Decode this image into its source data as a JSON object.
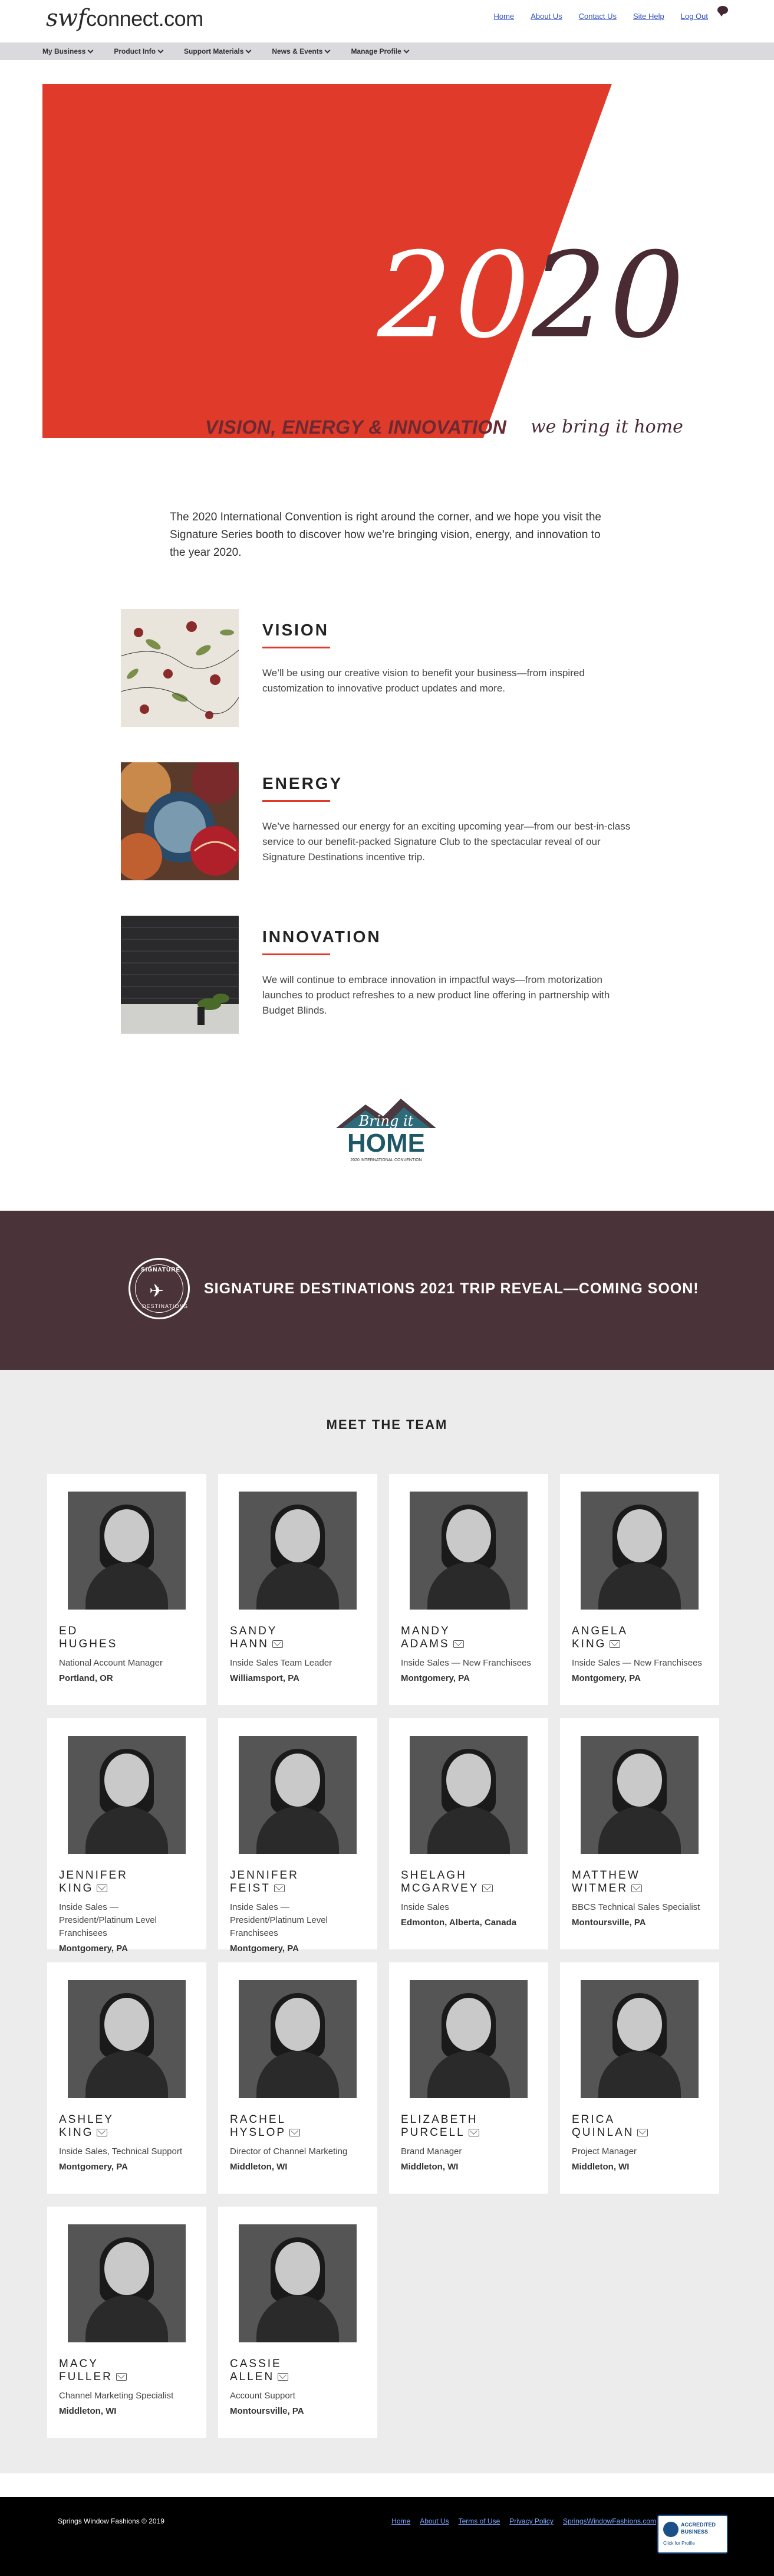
{
  "header": {
    "logo_swf": "swf",
    "logo_rest": "connect.com",
    "links": [
      "Home",
      "About Us",
      "Contact Us",
      "Site Help",
      "Log Out"
    ]
  },
  "nav": {
    "items": [
      "My Business",
      "Product Info",
      "Support Materials",
      "News & Events",
      "Manage Profile"
    ]
  },
  "hero": {
    "year_white": "20",
    "year_dark": "20",
    "tagline": "VISION, ENERGY & INNOVATION",
    "subtagline": "we bring it home",
    "colors": {
      "red": "#e03a2a",
      "dark": "#4a2a33"
    }
  },
  "intro": "The 2020 International Convention is right around the corner, and we hope you visit the Signature Series booth to discover how we’re bringing vision, energy, and innovation to the year 2020.",
  "features": [
    {
      "title": "VISION",
      "text": "We’ll be using our creative vision to benefit your business—from inspired customization to innovative product updates and more."
    },
    {
      "title": "ENERGY",
      "text": "We’ve harnessed our energy for an exciting upcoming year—from our best-in-class service to our benefit-packed Signature Club to the spectacular reveal of our Signature Destinations incentive trip."
    },
    {
      "title": "INNOVATION",
      "text": "We will continue to embrace innovation in impactful ways—from motorization launches to product refreshes to a new product line offering in partnership with Budget Blinds."
    }
  ],
  "bring_home": {
    "script": "Bring it",
    "word": "HOME",
    "caption": "2020 INTERNATIONAL CONVENTION"
  },
  "banner": {
    "text": "SIGNATURE DESTINATIONS 2021 TRIP REVEAL—COMING SOON!",
    "badge_top": "SIGNATURE",
    "badge_bottom": "DESTINATIONS"
  },
  "team": {
    "title": "MEET THE TEAM",
    "members": [
      {
        "name": "ED\nHUGHES",
        "role": "National Account Manager",
        "location": "Portland, OR",
        "mail": false
      },
      {
        "name": "SANDY\nHANN",
        "role": "Inside Sales Team Leader",
        "location": "Williamsport, PA",
        "mail": true
      },
      {
        "name": "MANDY\nADAMS",
        "role": "Inside Sales — New Franchisees",
        "location": "Montgomery, PA",
        "mail": true
      },
      {
        "name": "ANGELA\nKING",
        "role": "Inside Sales — New Franchisees",
        "location": "Montgomery, PA",
        "mail": true
      },
      {
        "name": "JENNIFER\nKING",
        "role": "Inside Sales — President/Platinum Level Franchisees",
        "location": "Montgomery, PA",
        "mail": true
      },
      {
        "name": "JENNIFER\nFEIST",
        "role": "Inside Sales — President/Platinum Level Franchisees",
        "location": "Montgomery, PA",
        "mail": true
      },
      {
        "name": "SHELAGH\nMCGARVEY",
        "role": "Inside Sales",
        "location": "Edmonton, Alberta, Canada",
        "mail": true
      },
      {
        "name": "MATTHEW\nWITMER",
        "role": "BBCS Technical Sales Specialist",
        "location": "Montoursville, PA",
        "mail": true
      },
      {
        "name": "ASHLEY\nKING",
        "role": "Inside Sales, Technical Support",
        "location": "Montgomery, PA",
        "mail": true
      },
      {
        "name": "RACHEL\nHYSLOP",
        "role": "Director of Channel Marketing",
        "location": "Middleton, WI",
        "mail": true
      },
      {
        "name": "ELIZABETH\nPURCELL",
        "role": "Brand Manager",
        "location": "Middleton, WI",
        "mail": true
      },
      {
        "name": "ERICA\nQUINLAN",
        "role": "Project Manager",
        "location": "Middleton, WI",
        "mail": true
      },
      {
        "name": "MACY\nFULLER",
        "role": "Channel Marketing Specialist",
        "location": "Middleton, WI",
        "mail": true
      },
      {
        "name": "CASSIE\nALLEN",
        "role": "Account Support",
        "location": "Montoursville, PA",
        "mail": true
      }
    ]
  },
  "footer": {
    "copyright": "Springs Window Fashions © 2019",
    "links": [
      "Home",
      "About Us",
      "Terms of Use",
      "Privacy Policy",
      "SpringsWindowFashions.com"
    ],
    "bbb_line1": "ACCREDITED",
    "bbb_line2": "BUSINESS",
    "bbb_line3": "Click for Profile"
  }
}
